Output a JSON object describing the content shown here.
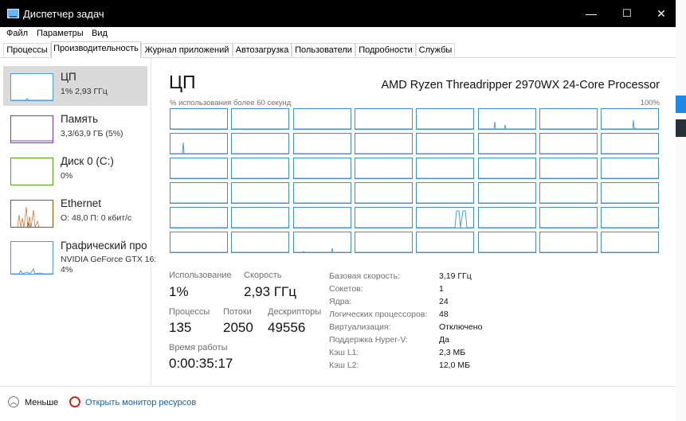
{
  "titlebar": {
    "title": "Диспетчер задач",
    "minimize": "—",
    "maximize": "☐",
    "close": "✕"
  },
  "menu": [
    "Файл",
    "Параметры",
    "Вид"
  ],
  "tabs": [
    "Процессы",
    "Производительность",
    "Журнал приложений",
    "Автозагрузка",
    "Пользователи",
    "Подробности",
    "Службы"
  ],
  "active_tab": "Производительность",
  "sidebar": [
    {
      "name": "ЦП",
      "sub": "1% 2,93 ГГц",
      "color": "#4c9ad6"
    },
    {
      "name": "Память",
      "sub": "3,3/63,9 ГБ (5%)",
      "color": "#8b2fc9"
    },
    {
      "name": "Диск 0 (C:)",
      "sub": "0%",
      "color": "#4da60c"
    },
    {
      "name": "Ethernet",
      "sub": "О: 48,0 П: 0 кбит/с",
      "color": "#a74f01"
    },
    {
      "name": "Графический про",
      "sub": "NVIDIA GeForce GTX 16:",
      "sub2": "4%",
      "color": "#4c9ad6"
    }
  ],
  "main": {
    "title": "ЦП",
    "processor": "AMD Ryzen Threadripper 2970WX 24-Core Processor",
    "graph_caption": "% использования более 60 секунд",
    "graph_max": "100%",
    "core_count": 48,
    "stats": {
      "usage_label": "Использование",
      "usage_value": "1%",
      "speed_label": "Скорость",
      "speed_value": "2,93 ГГц",
      "processes_label": "Процессы",
      "processes_value": "135",
      "threads_label": "Потоки",
      "threads_value": "2050",
      "handles_label": "Дескрипторы",
      "handles_value": "49556",
      "uptime_label": "Время работы",
      "uptime_value": "0:00:35:17"
    },
    "info": [
      {
        "k": "Базовая скорость:",
        "v": "3,19 ГГц"
      },
      {
        "k": "Сокетов:",
        "v": "1"
      },
      {
        "k": "Ядра:",
        "v": "24"
      },
      {
        "k": "Логических процессоров:",
        "v": "48"
      },
      {
        "k": "Виртуализация:",
        "v": "Отключено"
      },
      {
        "k": "Поддержка Hyper-V:",
        "v": "Да"
      },
      {
        "k": "Кэш L1:",
        "v": "2,3 МБ"
      },
      {
        "k": "Кэш L2:",
        "v": "12,0 МБ"
      }
    ]
  },
  "footer": {
    "less": "Меньше",
    "monitor": "Открыть монитор ресурсов"
  },
  "colors": {
    "cpu": "#4c9ad6",
    "memory": "#8b2fc9",
    "disk": "#4da60c",
    "ethernet": "#a74f01",
    "link": "#1a5fb4"
  }
}
